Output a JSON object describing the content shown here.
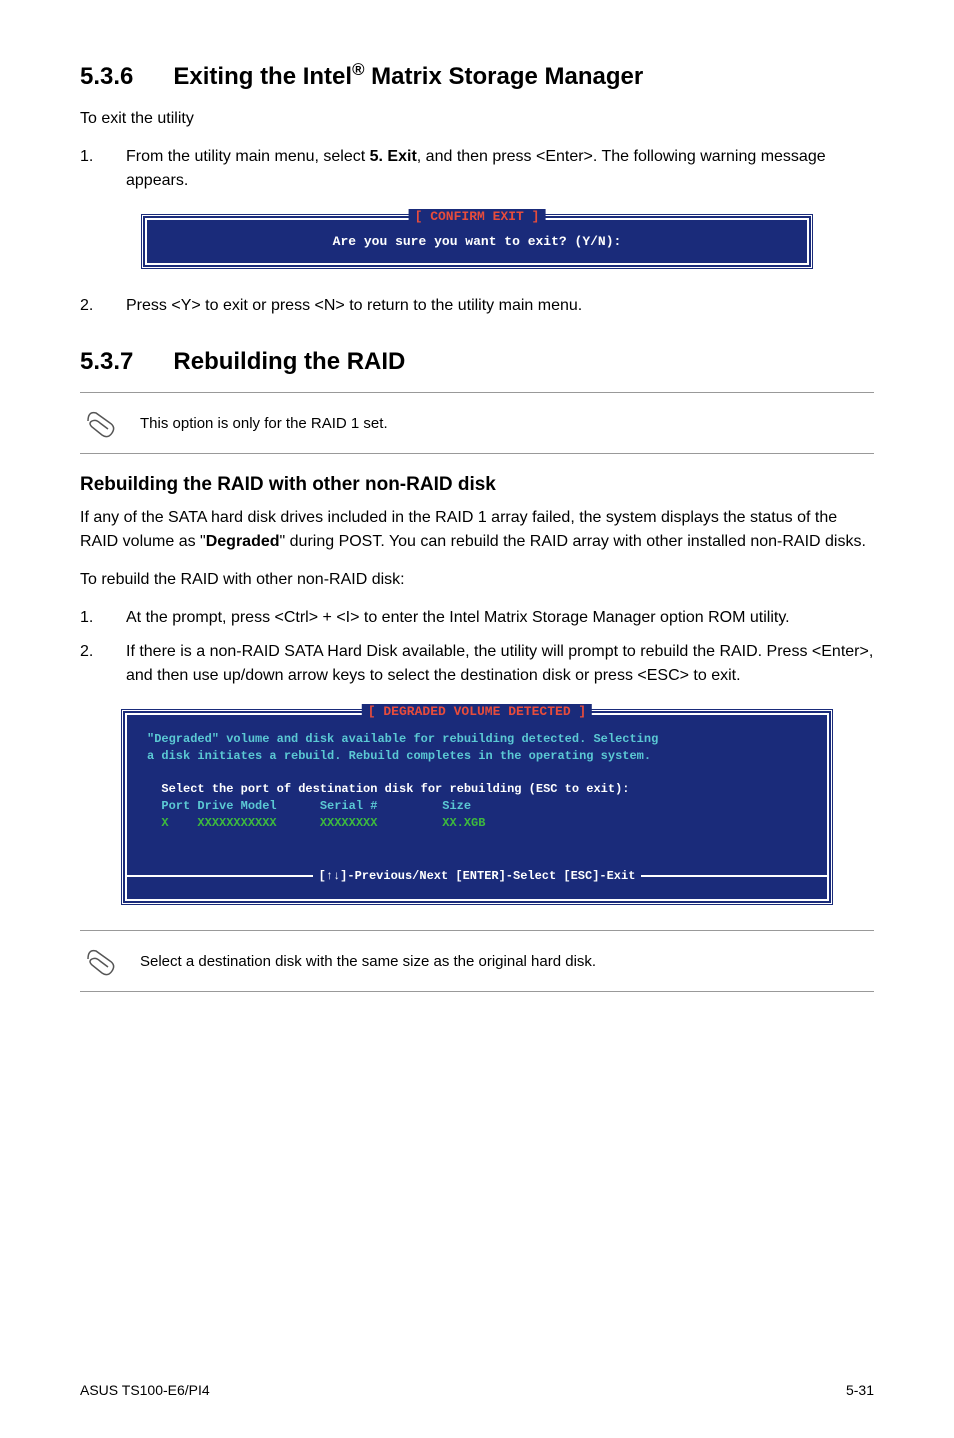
{
  "section1": {
    "number": "5.3.6",
    "title_pre": "Exiting the Intel",
    "title_sup": "®",
    "title_post": " Matrix Storage Manager",
    "intro": "To exit the utility",
    "step1_num": "1.",
    "step1_text_a": "From the utility main menu, select ",
    "step1_bold": "5. Exit",
    "step1_text_b": ", and then press <Enter>. The following warning message appears.",
    "terminal_title": "[ CONFIRM EXIT ]",
    "terminal_text": "Are you sure you want to exit? (Y/N):",
    "step2_num": "2.",
    "step2_text": "Press <Y> to exit or press <N> to return to the utility main menu."
  },
  "section2": {
    "number": "5.3.7",
    "title": "Rebuilding the RAID",
    "note1": "This option is only for the RAID 1 set.",
    "subheading": "Rebuilding the RAID with other non-RAID disk",
    "para1_a": "If any of the SATA hard disk drives included in the RAID 1 array failed, the system displays the status of the RAID volume as \"",
    "para1_bold": "Degraded",
    "para1_b": "\" during POST. You can rebuild the RAID array with other installed non-RAID disks.",
    "para2": "To rebuild the RAID with other non-RAID disk:",
    "step1_num": "1.",
    "step1_text": "At the prompt, press <Ctrl> + <I> to enter the Intel Matrix Storage Manager option ROM utility.",
    "step2_num": "2.",
    "step2_text": "If there is a non-RAID SATA Hard Disk available, the utility will prompt to rebuild the RAID. Press <Enter>, and then use up/down arrow keys to select the destination disk or press <ESC> to exit.",
    "terminal_title": "[ DEGRADED VOLUME DETECTED ]",
    "terminal_line1": "\"Degraded\" volume and disk available for rebuilding detected. Selecting",
    "terminal_line2": "a disk initiates a rebuild. Rebuild completes in the operating system.",
    "terminal_select": "Select the port of destination disk for rebuilding (ESC to exit):",
    "terminal_header": "Port Drive Model      Serial #         Size",
    "terminal_row": "X    XXXXXXXXXXX      XXXXXXXX         XX.XGB",
    "terminal_footer": "[↑↓]-Previous/Next  [ENTER]-Select  [ESC]-Exit",
    "note2": "Select a destination disk with the same size as the original hard disk."
  },
  "footer": {
    "left": "ASUS TS100-E6/PI4",
    "right": "5-31"
  }
}
